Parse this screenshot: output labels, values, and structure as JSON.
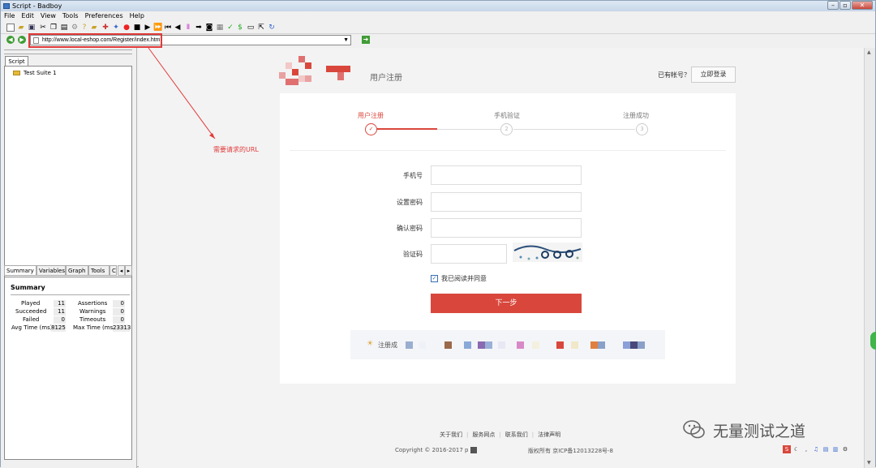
{
  "window": {
    "title": "Script - Badboy"
  },
  "menu": [
    "File",
    "Edit",
    "View",
    "Tools",
    "Preferences",
    "Help"
  ],
  "url_bar": {
    "value": "http://www.local-eshop.com/Register/index.html"
  },
  "left_pane": {
    "tab": "Script",
    "tree_item": "Test Suite 1",
    "summary_tabs": [
      "Summary",
      "Variables",
      "Graph",
      "Tools",
      "C"
    ],
    "summary": {
      "heading": "Summary",
      "played_label": "Played",
      "played": "11",
      "succeeded_label": "Succeeded",
      "succeeded": "11",
      "failed_label": "Failed",
      "failed": "0",
      "avg_label": "Avg Time (ms)",
      "avg": "8125",
      "assertions_label": "Assertions",
      "assertions": "0",
      "warnings_label": "Warnings",
      "warnings": "0",
      "timeouts_label": "Timeouts",
      "timeouts": "0",
      "max_label": "Max Time (ms)",
      "max": "23313"
    }
  },
  "annotation": {
    "text": "需要请求的URL",
    "color": "#e23a3a"
  },
  "page": {
    "heading": "用户注册",
    "has_account": "已有帐号？",
    "login_button": "立即登录",
    "steps": [
      {
        "label": "用户注册",
        "marker": "✓"
      },
      {
        "label": "手机验证",
        "marker": "2"
      },
      {
        "label": "注册成功",
        "marker": "3"
      }
    ],
    "form": {
      "phone_label": "手机号",
      "password_label": "设置密码",
      "confirm_label": "确认密码",
      "captcha_label": "验证码",
      "agree_text": "我已阅读并同意",
      "next_button": "下一步"
    },
    "notice_prefix": "注册成",
    "footer": {
      "links": [
        "关于我们",
        "服务网点",
        "联系我们",
        "法律声明"
      ],
      "copyright": "Copyright © 2016-2017",
      "copyright_tail": "p",
      "icp": "版权所有 京ICP备12013228号-8"
    },
    "colors": {
      "accent": "#d9473c",
      "active_step": "#d9473c"
    }
  },
  "watermark": {
    "text": "无量测试之道"
  }
}
